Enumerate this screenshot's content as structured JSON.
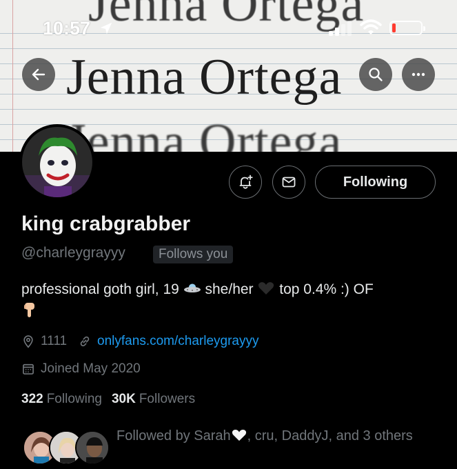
{
  "status_bar": {
    "time": "10:57"
  },
  "banner": {
    "lines": [
      "Jenna Ortega",
      "Jenna Ortega",
      "Jenna Ortega"
    ]
  },
  "profile": {
    "display_name": "king crabgrabber",
    "handle": "@charleygrayyy",
    "follows_you": "Follows you",
    "bio_part1": "professional goth girl, 19",
    "bio_part2": " she/her",
    "bio_part3": " top 0.4% :) OF",
    "location": "1111",
    "website": "onlyfans.com/charleygrayyy",
    "joined": "Joined May 2020",
    "following_count": "322",
    "following_label": "Following",
    "followers_count": "30K",
    "followers_label": "Followers",
    "followed_by_1": "Followed by Sarah",
    "followed_by_2": ", cru, DaddyJ, and 3 others"
  },
  "actions": {
    "following_button": "Following"
  },
  "icons": {
    "back": "arrow-left-icon",
    "search": "search-icon",
    "more": "more-horizontal-icon",
    "notify": "bell-plus-icon",
    "message": "envelope-icon",
    "location": "location-pin-icon",
    "link": "link-icon",
    "calendar": "calendar-icon"
  },
  "colors": {
    "link": "#1d9bf0",
    "muted": "#71767b",
    "text": "#e7e9ea",
    "background": "#000000"
  }
}
